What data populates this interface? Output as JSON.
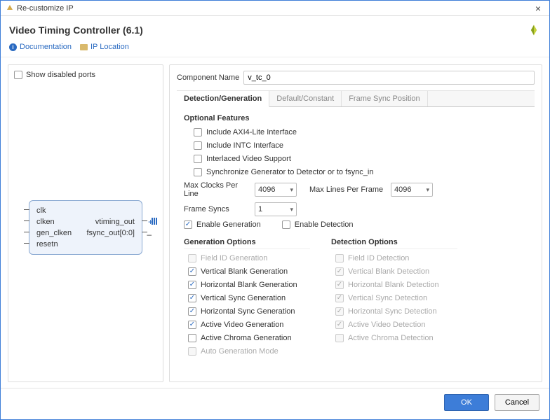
{
  "window": {
    "title": "Re-customize IP"
  },
  "header": {
    "title": "Video Timing Controller (6.1)"
  },
  "links": {
    "doc": "Documentation",
    "iploc": "IP Location"
  },
  "left": {
    "show_disabled": {
      "label": "Show disabled ports",
      "checked": false
    },
    "ip": {
      "ports_left": [
        "clk",
        "clken",
        "gen_clken",
        "resetn"
      ],
      "ports_right": [
        "vtiming_out",
        "fsync_out[0:0]"
      ]
    }
  },
  "right": {
    "comp_label": "Component Name",
    "comp_value": "v_tc_0",
    "tabs": [
      "Detection/Generation",
      "Default/Constant",
      "Frame Sync Position"
    ],
    "active_tab": 0,
    "optional_title": "Optional Features",
    "features": [
      {
        "label": "Include AXI4-Lite Interface",
        "checked": false
      },
      {
        "label": "Include INTC Interface",
        "checked": false
      },
      {
        "label": "Interlaced Video Support",
        "checked": false
      },
      {
        "label": "Synchronize Generator to Detector or to fsync_in",
        "checked": false
      }
    ],
    "maxclk_label": "Max Clocks Per Line",
    "maxclk_value": "4096",
    "maxln_label": "Max Lines Per Frame",
    "maxln_value": "4096",
    "fsync_label": "Frame Syncs",
    "fsync_value": "1",
    "enable_gen": {
      "label": "Enable Generation",
      "checked": true
    },
    "enable_det": {
      "label": "Enable Detection",
      "checked": false
    },
    "gen": {
      "title": "Generation Options",
      "items": [
        {
          "label": "Field ID Generation",
          "checked": false,
          "disabled": true
        },
        {
          "label": "Vertical Blank Generation",
          "checked": true,
          "disabled": false
        },
        {
          "label": "Horizontal Blank Generation",
          "checked": true,
          "disabled": false
        },
        {
          "label": "Vertical Sync Generation",
          "checked": true,
          "disabled": false
        },
        {
          "label": "Horizontal Sync Generation",
          "checked": true,
          "disabled": false
        },
        {
          "label": "Active Video Generation",
          "checked": true,
          "disabled": false
        },
        {
          "label": "Active Chroma Generation",
          "checked": false,
          "disabled": false
        },
        {
          "label": "Auto Generation Mode",
          "checked": false,
          "disabled": true
        }
      ]
    },
    "det": {
      "title": "Detection Options",
      "items": [
        {
          "label": "Field ID Detection",
          "checked": false,
          "disabled": true
        },
        {
          "label": "Vertical Blank Detection",
          "checked": true,
          "disabled": true
        },
        {
          "label": "Horizontal Blank Detection",
          "checked": true,
          "disabled": true
        },
        {
          "label": "Vertical Sync Detection",
          "checked": true,
          "disabled": true
        },
        {
          "label": "Horizontal Sync Detection",
          "checked": true,
          "disabled": true
        },
        {
          "label": "Active Video Detection",
          "checked": true,
          "disabled": true
        },
        {
          "label": "Active Chroma Detection",
          "checked": false,
          "disabled": true
        }
      ]
    }
  },
  "footer": {
    "ok": "OK",
    "cancel": "Cancel"
  }
}
